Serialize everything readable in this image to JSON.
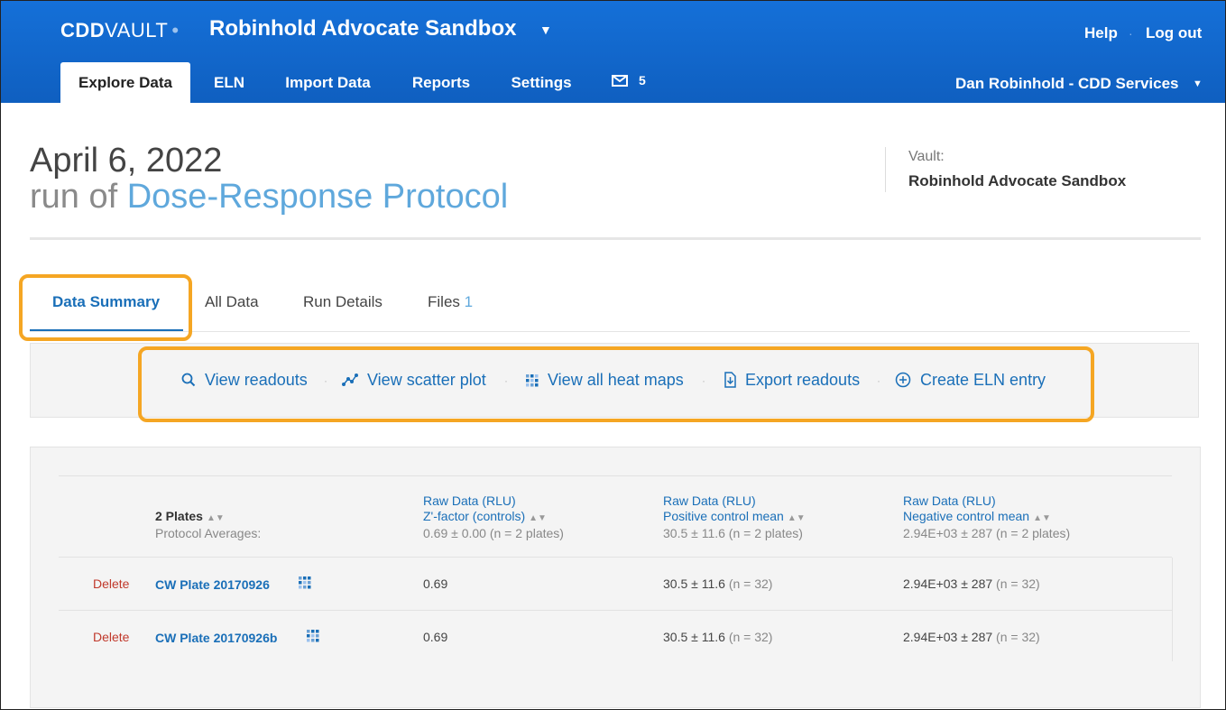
{
  "header": {
    "logo_main": "CDD",
    "logo_sub": "VAULT",
    "vault_title": "Robinhold Advocate Sandbox",
    "help": "Help",
    "logout": "Log out",
    "nav": [
      "Explore Data",
      "ELN",
      "Import Data",
      "Reports",
      "Settings"
    ],
    "message_count": "5",
    "user": "Dan Robinhold - CDD Services"
  },
  "page": {
    "date": "April 6, 2022",
    "run_of": "run of",
    "protocol": "Dose-Response Protocol",
    "vault_label": "Vault:",
    "vault_name": "Robinhold Advocate Sandbox"
  },
  "tabs": {
    "data_summary": "Data Summary",
    "all_data": "All Data",
    "run_details": "Run Details",
    "files": "Files",
    "files_count": "1"
  },
  "actions": {
    "view_readouts": "View readouts",
    "view_scatter": "View scatter plot",
    "view_heatmaps": "View all heat maps",
    "export": "Export readouts",
    "create_eln": "Create ELN entry"
  },
  "table": {
    "plates_header": "2 Plates",
    "protocol_averages": "Protocol Averages:",
    "columns": [
      {
        "group": "Raw Data (RLU)",
        "name": "Z'-factor (controls)",
        "avg": "0.69 ± 0.00 (n = 2 plates)"
      },
      {
        "group": "Raw Data (RLU)",
        "name": "Positive control mean",
        "avg": "30.5 ± 11.6 (n = 2 plates)"
      },
      {
        "group": "Raw Data (RLU)",
        "name": "Negative control mean",
        "avg": "2.94E+03 ± 287 (n = 2 plates)"
      }
    ],
    "rows": [
      {
        "delete": "Delete",
        "plate": "CW Plate 20170926",
        "z": "0.69",
        "pos": "30.5 ± 11.6",
        "pos_n": "(n = 32)",
        "neg": "2.94E+03 ± 287",
        "neg_n": "(n = 32)"
      },
      {
        "delete": "Delete",
        "plate": "CW Plate 20170926b",
        "z": "0.69",
        "pos": "30.5 ± 11.6",
        "pos_n": "(n = 32)",
        "neg": "2.94E+03 ± 287",
        "neg_n": "(n = 32)"
      }
    ]
  },
  "colors": {
    "brand_blue": "#1570d8",
    "link_blue": "#1a6fb8",
    "highlight": "#f5a623",
    "delete_red": "#c0392b"
  }
}
